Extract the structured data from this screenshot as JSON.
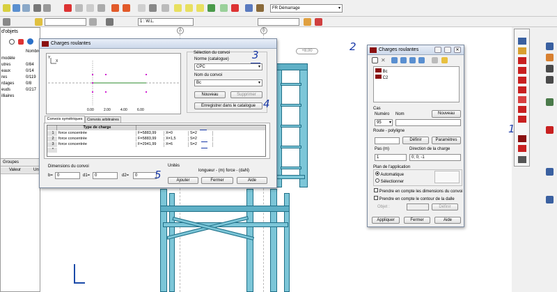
{
  "toolbar": {
    "combo_case": "FR Démarrage",
    "combo_view": "1 : W.L."
  },
  "sidebar": {
    "title": "d'objets",
    "col_nombre": "Nombre",
    "rows": [
      {
        "name": "modèle",
        "count": ""
      },
      {
        "name": "utres",
        "count": "0/84"
      },
      {
        "name": "eaux",
        "count": "0/14"
      },
      {
        "name": "res",
        "count": "0/119"
      },
      {
        "name": "rdages",
        "count": "0/8"
      },
      {
        "name": "euds",
        "count": "0/217"
      },
      {
        "name": "illiaires",
        "count": ""
      }
    ],
    "tab_groupes": "Groupes",
    "col_valeur": "Valeur",
    "col_un": "Un"
  },
  "view": {
    "markers": [
      "A",
      "B"
    ],
    "dim_label": "+8,00"
  },
  "dialog_left": {
    "title": "Charges roulantes",
    "preview": {
      "ticks": [
        "0.00",
        "2.00",
        "4.00",
        "6.00"
      ],
      "axis_y": "Y",
      "axis_x": "X"
    },
    "selection_group": "Sélection du convoi",
    "norm_label": "Norme (catalogue)",
    "norm_value": "CPC",
    "convoy_name_label": "Nom du convoi",
    "convoy_name_value": "Bc",
    "btn_new": "Nouveau",
    "btn_delete": "Supprimer",
    "btn_save_catalog": "Enregistrer dans le catalogue",
    "tab_symmetric": "Convois symétriques",
    "tab_arbitrary": "Convois arbitraires",
    "table": {
      "header": "Type de charge",
      "rows": [
        {
          "n": "1",
          "type": "force concentrée",
          "f": "F=5883,99",
          "x": "X=0",
          "s": "S=2"
        },
        {
          "n": "2",
          "type": "force concentrée",
          "f": "F=5883,99",
          "x": "X=1,5",
          "s": "S=2"
        },
        {
          "n": "3",
          "type": "force concentrée",
          "f": "F=2941,99",
          "x": "X=6",
          "s": "S=2"
        },
        {
          "n": "*",
          "type": "",
          "f": "",
          "x": "",
          "s": ""
        }
      ]
    },
    "dims_label": "Dimensions du convoi",
    "b_label": "b=",
    "b_value": "0",
    "d1_label": "d1=",
    "d1_value": "0",
    "d2_label": "d2=",
    "d2_value": "0",
    "units_label": "Unités",
    "units_value": "longueur - (m)   force - (daN)",
    "btn_add": "Ajouter",
    "btn_close": "Fermer",
    "btn_help": "Aide"
  },
  "dialog_right": {
    "title": "Charges roulantes",
    "tree": [
      "Bc",
      "C2"
    ],
    "cas_label": "Cas",
    "numero_label": "Numéro",
    "nom_label": "Nom",
    "numero_value": "95",
    "btn_new": "Nouveau",
    "route_label": "Route - polyligne",
    "btn_define": "Définir",
    "btn_params": "Paramètres",
    "step_label": "Pas (m)",
    "step_value": "1",
    "dir_label": "Direction de la charge",
    "dir_value": "0; 0; -1",
    "plane_label": "Plan de l'application",
    "radio_auto": "Automatique",
    "radio_select": "Sélectionner",
    "chk_dims": "Prendre en compte les dimensions du convoi",
    "chk_slab": "Prendre en compte le contour de la dalle",
    "objet_label": "Objet :",
    "btn_define2": "Définir",
    "btn_apply": "Appliquer",
    "btn_close": "Fermer",
    "btn_help": "Aide"
  },
  "annotations": [
    "1",
    "2",
    "3",
    "4",
    "5"
  ],
  "colors": {
    "steel": "#7cc6d8",
    "steel_edge": "#1f6f87",
    "load_marker": "#d11fd1",
    "handwriting": "#1a3aa8"
  }
}
